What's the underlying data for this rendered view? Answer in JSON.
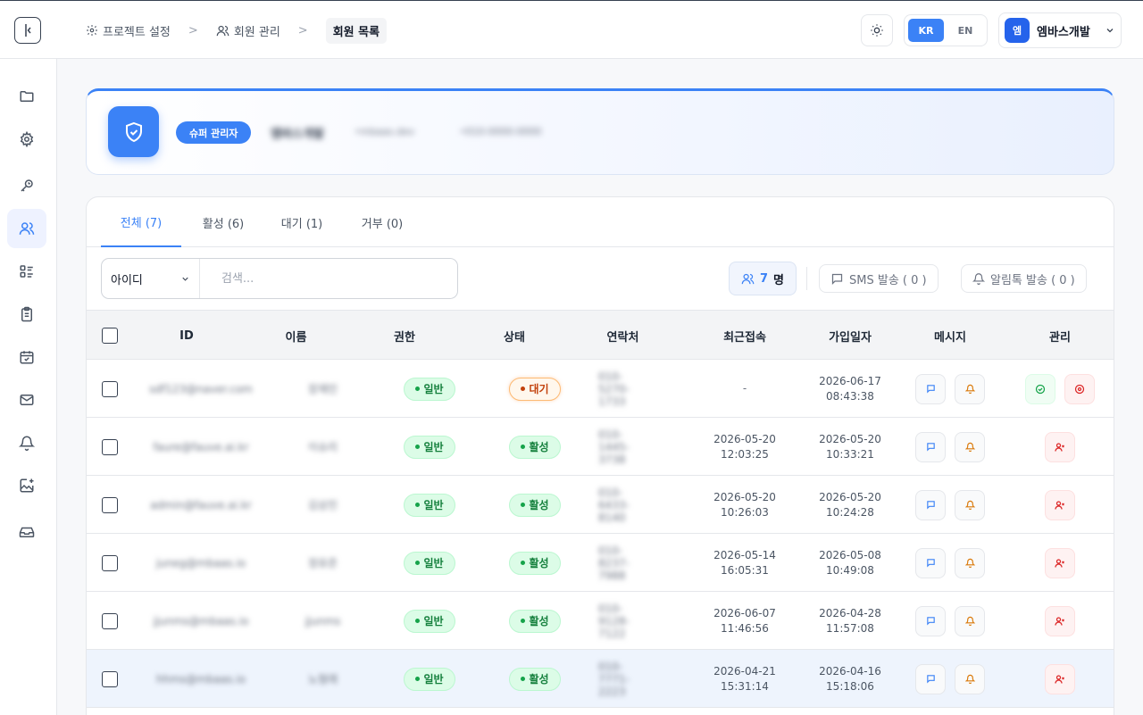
{
  "breadcrumb": {
    "items": [
      "프로젝트 설정",
      "회원 관리",
      "회원 목록"
    ]
  },
  "header": {
    "lang_kr": "KR",
    "lang_en": "EN",
    "active_lang": "KR",
    "user_initial": "엠",
    "user_name": "엠바스개발"
  },
  "admin": {
    "role": "슈퍼 관리자",
    "name": "엠바스개발",
    "email": "•mbaas.dev",
    "phone": "•010-0000-0000"
  },
  "tabs": [
    {
      "label": "전체 (7)",
      "active": true
    },
    {
      "label": "활성 (6)",
      "active": false
    },
    {
      "label": "대기 (1)",
      "active": false
    },
    {
      "label": "거부 (0)",
      "active": false
    }
  ],
  "search": {
    "field": "아이디",
    "placeholder": "검색..."
  },
  "toolbar": {
    "count_value": "7",
    "count_unit": "명",
    "sms_label": "SMS 발송 ( 0 )",
    "alimtalk_label": "알림톡 발송 ( 0 )"
  },
  "table": {
    "headers": [
      "ID",
      "이름",
      "권한",
      "상태",
      "연락처",
      "최근접속",
      "가입일자",
      "메시지",
      "관리"
    ],
    "rows": [
      {
        "id": "sdf123@naver.com",
        "name": "장재민",
        "role": "일반",
        "status": "대기",
        "phone": "010-5270-1733",
        "last_login_date": "-",
        "last_login_time": "",
        "join_date": "2026-06-17",
        "join_time": "08:43:38"
      },
      {
        "id": "faure@fauve.ai.kr",
        "name": "이슈리",
        "role": "일반",
        "status": "활성",
        "phone": "010-1445-3738",
        "last_login_date": "2026-05-20",
        "last_login_time": "12:03:25",
        "join_date": "2026-05-20",
        "join_time": "10:33:21"
      },
      {
        "id": "admin@fauve.ai.kr",
        "name": "김상진",
        "role": "일반",
        "status": "활성",
        "phone": "010-6433-8140",
        "last_login_date": "2026-05-20",
        "last_login_time": "10:26:03",
        "join_date": "2026-05-20",
        "join_time": "10:24:28"
      },
      {
        "id": "juneg@mbaas.io",
        "name": "정유준",
        "role": "일반",
        "status": "활성",
        "phone": "010-8237-7988",
        "last_login_date": "2026-05-14",
        "last_login_time": "16:05:31",
        "join_date": "2026-05-08",
        "join_time": "10:49:08"
      },
      {
        "id": "jjunms@mbaas.io",
        "name": "jjunms",
        "role": "일반",
        "status": "활성",
        "phone": "010-9128-7122",
        "last_login_date": "2026-06-07",
        "last_login_time": "11:46:56",
        "join_date": "2026-04-28",
        "join_time": "11:57:08"
      },
      {
        "id": "hhms@mbaas.io",
        "name": "노형래",
        "role": "일반",
        "status": "활성",
        "phone": "010-7771-2223",
        "last_login_date": "2026-04-21",
        "last_login_time": "15:31:14",
        "join_date": "2026-04-16",
        "join_time": "15:18:06"
      }
    ]
  },
  "colors": {
    "accent": "#3b82f6",
    "active_green": "#15803d",
    "pending_orange": "#c2410c",
    "danger_red": "#dc2626"
  },
  "icons": {
    "sidebar_toggle": "sidebar-toggle-icon",
    "nav": [
      "folder-icon",
      "gear-icon",
      "key-icon",
      "users-icon",
      "list-icon",
      "clipboard-icon",
      "calendar-check-icon",
      "mail-icon",
      "bell-icon",
      "image-plus-icon",
      "inbox-icon"
    ]
  }
}
